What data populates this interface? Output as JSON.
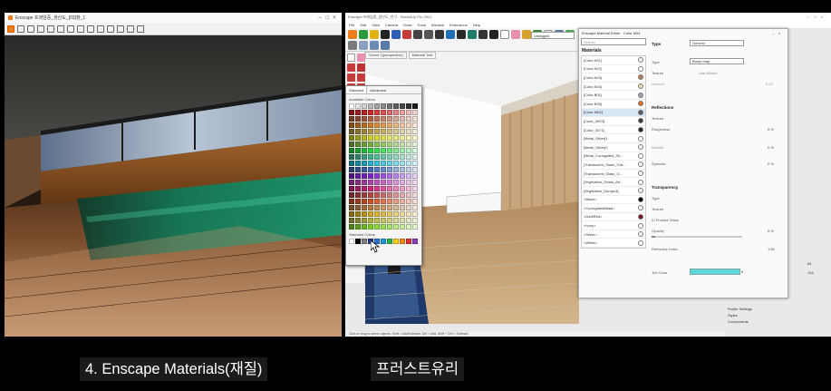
{
  "left_window": {
    "title": "Enscape  프레임중_생산도_[03]창_1",
    "controls": [
      "–",
      "□",
      "×"
    ]
  },
  "sketchup": {
    "title": "Enscape 프레임중_생산도_연구 - SketchUp Pro 2021",
    "menu": [
      "File",
      "Edit",
      "View",
      "Camera",
      "Draw",
      "Tools",
      "Window",
      "Extensions",
      "Help"
    ],
    "tag_select": "Untagged",
    "scene_tabs": [
      "Scene 1(perspective)",
      "Material Test"
    ],
    "status_bar": "Click or drag to select objects. Shift = Add/Subtract. Ctrl = Add. Shift + Ctrl = Subtract.",
    "tray_items": [
      "Profile Settings",
      "Styles",
      "Components"
    ],
    "tray_values": [
      "84",
      "104"
    ]
  },
  "material_editor": {
    "title": "Enscape Material Editor",
    "material_name": "Color M04",
    "search_placeholder": "Search",
    "materials_header": "Materials",
    "materials": [
      {
        "name": "[Color A01]",
        "color": "#ffffff"
      },
      {
        "name": "[Color A02]",
        "color": "#ffffff"
      },
      {
        "name": "[Color A03]",
        "color": "#b77a55"
      },
      {
        "name": "[Color A04]",
        "color": "#f0d9b5"
      },
      {
        "name": "[Color B01]",
        "color": "#9aa6b2"
      },
      {
        "name": "[Color B05]",
        "color": "#e46a1c"
      },
      {
        "name": "[Color M04]",
        "color": "#5a5a5a"
      },
      {
        "name": "[Color_0003]",
        "color": "#3b3b3b"
      },
      {
        "name": "[Color_0071]",
        "color": "#242424"
      },
      {
        "name": "[Metal_Silver]1",
        "color": "#ffffff"
      },
      {
        "name": "[Metal_Silver]2",
        "color": "#ffffff"
      },
      {
        "name": "[Metal_Corrugated_Sh...",
        "color": "#ffffff"
      },
      {
        "name": "[Translucent_Glass_Gra...",
        "color": "#ffffff"
      },
      {
        "name": "[Translucent_Glass_G...",
        "color": "#ffffff"
      },
      {
        "name": "[Vegetation_Grass_Art...",
        "color": "#ffffff"
      },
      {
        "name": "[Vegetation_Dumpo3]",
        "color": "#ffffff"
      },
      {
        "name": "<Black>",
        "color": "#000000"
      },
      {
        "name": "<CorrugatedMetal>",
        "color": "#ffffff"
      },
      {
        "name": "<DarkRed>",
        "color": "#7b1515"
      },
      {
        "name": "<Ivory>",
        "color": "#ffffff"
      },
      {
        "name": "<Silver>",
        "color": "#ffffff"
      },
      {
        "name": "<White>",
        "color": "#ffffff"
      }
    ],
    "type_label": "Type",
    "type_value": "Generic",
    "bump_type_label": "Type",
    "bump_type_value": "Bump map",
    "texture_label": "Texture",
    "use_albedo": "Use Albedo",
    "amount_label": "Amount",
    "amount_value": "0.03",
    "reflections_header": "Reflections",
    "roughness_label": "Roughness",
    "roughness_value": "0 %",
    "metallic_label": "Metallic",
    "metallic_value": "0 %",
    "specular_label": "Specular",
    "specular_value": "0 %",
    "transparency_header": "Transparency",
    "trans_type_label": "Type",
    "trans_texture_label": "Texture",
    "frosted_glass": "Frosted Glass",
    "opacity_label": "Opacity",
    "opacity_value": "0 %",
    "refractive_label": "Refractive Index",
    "refractive_value": "1.50",
    "tint_label": "Tint Color",
    "tint_color": "#5fd6d7"
  },
  "color_picker": {
    "tabs": [
      "Standard",
      "Advanced"
    ],
    "available_label": "Available Colors",
    "standard_label": "Standard Colors",
    "standard_colors": [
      "#ffffff",
      "#000000",
      "#7f7f7f",
      "#1f3b8a",
      "#2e6fd8",
      "#1e9ad6",
      "#2bb24c",
      "#f5d01a",
      "#f08a1a",
      "#d83131",
      "#8a3bb8"
    ]
  },
  "captions": {
    "left": "4. Enscape Materials(재질)",
    "right": "프러스트유리"
  }
}
